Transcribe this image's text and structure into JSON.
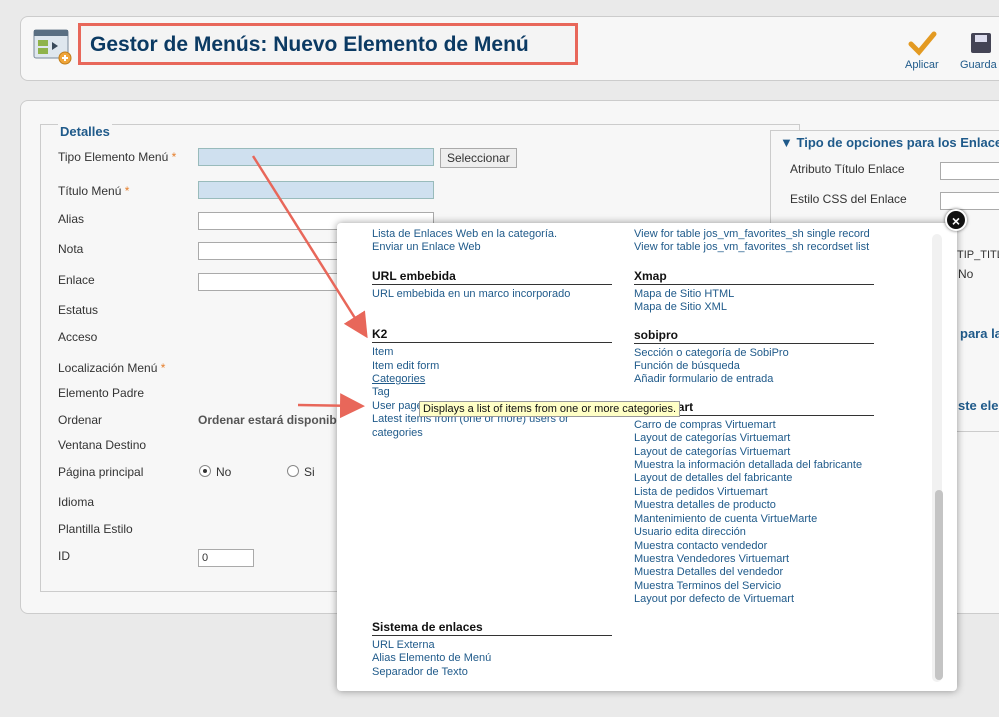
{
  "header": {
    "title": "Gestor de Menús: Nuevo Elemento de Menú",
    "buttons": [
      {
        "label": "Aplicar"
      },
      {
        "label": "Guarda"
      }
    ]
  },
  "details": {
    "legend": "Detalles",
    "fields": {
      "tipo": "Tipo Elemento Menú",
      "titulo": "Título Menú",
      "alias": "Alias",
      "nota": "Nota",
      "enlace": "Enlace",
      "estatus": "Estatus",
      "acceso": "Acceso",
      "localizacion": "Localización Menú",
      "padre": "Elemento Padre",
      "ordenar": "Ordenar",
      "ventana": "Ventana Destino",
      "principal": "Página principal",
      "idioma": "Idioma",
      "plantilla": "Plantilla Estilo",
      "id": "ID"
    },
    "required_mark": "*",
    "select_button": "Seleccionar",
    "ordenar_text": "Ordenar estará disponib",
    "radio_no": "No",
    "radio_si": "Si",
    "id_value": "0"
  },
  "right_panel": {
    "title": "Tipo de opciones para los Enlace",
    "attr_title": "Atributo Título Enlace",
    "css_style": "Estilo CSS del Enlace",
    "partial1": "TIP_TITL",
    "partial_no": "No",
    "partial2": "para la",
    "partial3": "ste ele"
  },
  "modal": {
    "left_col": {
      "top_links": [
        "Lista de Enlaces Web en la categoría.",
        "Enviar un Enlace Web"
      ],
      "groups": [
        {
          "title": "URL embebida",
          "items": [
            "URL embebida en un marco incorporado"
          ]
        },
        {
          "title": "K2",
          "items": [
            "Item",
            "Item edit form",
            "Categories",
            "Tag",
            "User page",
            "Latest items from (one or more) users or",
            "categories"
          ]
        },
        {
          "title": "Sistema de enlaces",
          "items": [
            "URL Externa",
            "Alias Elemento de Menú",
            "Separador de Texto"
          ]
        }
      ]
    },
    "right_col": {
      "top_links": [
        "View for table jos_vm_favorites_sh single record",
        "View for table jos_vm_favorites_sh recordset list"
      ],
      "groups": [
        {
          "title": "Xmap",
          "items": [
            "Mapa de Sitio HTML",
            "Mapa de Sitio XML"
          ]
        },
        {
          "title": "sobipro",
          "items": [
            "Sección o categoría de SobiPro",
            "Función de búsqueda",
            "Añadir formulario de entrada"
          ]
        },
        {
          "title": "VirtueMart",
          "items": [
            "Carro de compras Virtuemart",
            "Layout de categorías Virtuemart",
            "Layout de categorías Virtuemart",
            "Muestra la información detallada del fabricante",
            "Layout de detalles del fabricante",
            "Lista de pedidos Virtuemart",
            "Muestra detalles de producto",
            "Mantenimiento de cuenta VirtueMarte",
            "Usuario edita dirección",
            "Muestra contacto vendedor",
            "Muestra Vendedores Virtuemart",
            "Muestra Detalles del vendedor",
            "Muestra Terminos del Servicio",
            "Layout por defecto de Virtuemart"
          ]
        }
      ]
    },
    "close_glyph": "×",
    "tooltip": "Displays a list of items from one or more categories."
  },
  "colors": {
    "accent": "#1f5a8a",
    "highlight": "#e8675a"
  }
}
